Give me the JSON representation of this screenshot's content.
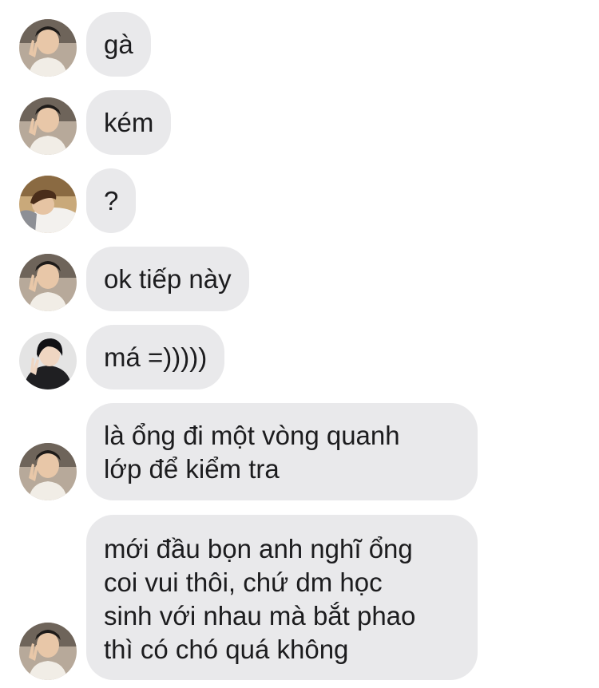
{
  "conversation": {
    "messages": [
      {
        "text": "gà",
        "avatar": "boy-peace-sign"
      },
      {
        "text": "kém",
        "avatar": "boy-peace-sign"
      },
      {
        "text": "?",
        "avatar": "boy-lying-pillow"
      },
      {
        "text": "ok tiếp này",
        "avatar": "boy-peace-sign"
      },
      {
        "text": "má =)))))",
        "avatar": "boy-dark-jacket"
      },
      {
        "text": "là ổng đi một vòng quanh\nlớp để kiểm tra",
        "avatar": "boy-peace-sign"
      },
      {
        "text": "mới đầu bọn anh nghĩ ổng\ncoi vui thôi, chứ dm học\nsinh với nhau mà bắt phao\nthì có chó quá không",
        "avatar": "boy-peace-sign"
      }
    ]
  },
  "colors": {
    "bubble": "#e9e9eb",
    "text": "#1c1c1e",
    "background": "#ffffff"
  }
}
